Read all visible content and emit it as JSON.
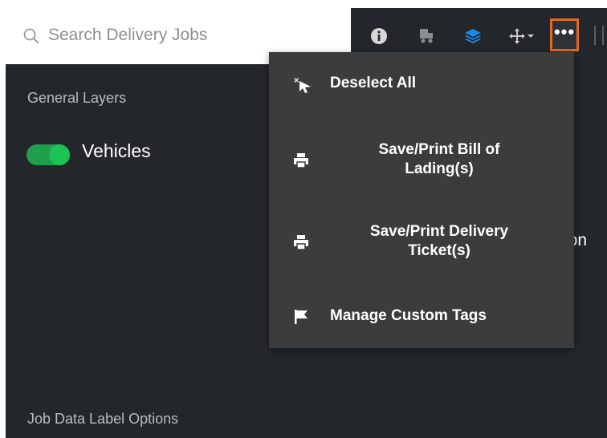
{
  "search": {
    "placeholder": "Search Delivery Jobs",
    "icon": "search-icon"
  },
  "toolbar": {
    "icons": [
      "info-icon",
      "truck-icon",
      "layers-icon",
      "move-icon",
      "more-icon"
    ],
    "active_color": "#1e88e5",
    "highlight_color": "#e36a20",
    "more_label": "•••"
  },
  "left_panel": {
    "general_layers_label": "General Layers",
    "vehicles_label": "Vehicles",
    "vehicles_toggle_on": true,
    "job_data_label_options": "Job Data Label Options",
    "partial_text": "ion"
  },
  "menu": {
    "items": [
      {
        "icon": "deselect-cursor-icon",
        "label": "Deselect All"
      },
      {
        "icon": "printer-icon",
        "label": "Save/Print Bill of Lading(s)"
      },
      {
        "icon": "printer-icon",
        "label": "Save/Print Delivery Ticket(s)"
      },
      {
        "icon": "flag-icon",
        "label": "Manage Custom Tags"
      }
    ]
  }
}
